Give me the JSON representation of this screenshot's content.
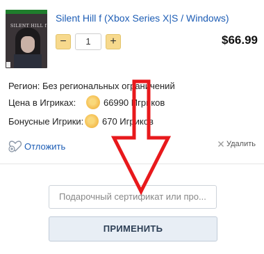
{
  "product": {
    "title": "Silent Hill f (Xbox Series X|S / Windows)",
    "cover_title": "SILENT HILL f",
    "quantity": "1",
    "minus_label": "−",
    "plus_label": "+",
    "price": "$66.99"
  },
  "details": {
    "region_label": "Регион:",
    "region_value": "Без региональных ограничений",
    "igriki_label": "Цена в Игриках:",
    "igriki_value": "66990 Игриков",
    "bonus_label": "Бонусные Игрики:",
    "bonus_value": "670 Игриков"
  },
  "actions": {
    "save_label": "Отложить",
    "remove_label": "Удалить"
  },
  "coupon": {
    "placeholder": "Подарочный сертификат или про...",
    "apply_label": "ПРИМЕНИТЬ"
  },
  "colors": {
    "link_blue": "#1d5db5",
    "stepper_yellow": "#f7d98d",
    "arrow_red": "#e8191c"
  }
}
